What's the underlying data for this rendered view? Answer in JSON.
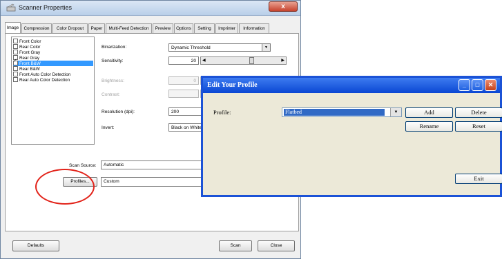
{
  "scanner_window": {
    "title": "Scanner Properties",
    "close_glyph": "x",
    "tabs": [
      "Image",
      "Compression",
      "Color Dropout",
      "Paper",
      "Multi-Feed Detection",
      "Preview",
      "Options",
      "Setting",
      "Imprinter",
      "Information"
    ],
    "active_tab": "Image",
    "image_list": [
      {
        "label": "Front Color",
        "checked": false,
        "selected": false
      },
      {
        "label": "Rear Color",
        "checked": false,
        "selected": false
      },
      {
        "label": "Front Gray",
        "checked": false,
        "selected": false
      },
      {
        "label": "Rear Gray",
        "checked": false,
        "selected": false
      },
      {
        "label": "Front B&W",
        "checked": true,
        "selected": true
      },
      {
        "label": "Rear B&W",
        "checked": false,
        "selected": false
      },
      {
        "label": "Front Auto Color Detection",
        "checked": false,
        "selected": false
      },
      {
        "label": "Rear Auto Color Detection",
        "checked": false,
        "selected": false
      }
    ],
    "settings": {
      "binarization_label": "Binarization:",
      "binarization_value": "Dynamic Threshold",
      "sensitivity_label": "Sensitivity:",
      "sensitivity_value": "20",
      "brightness_label": "Brightness:",
      "brightness_value": "0",
      "contrast_label": "Contrast:",
      "resolution_label": "Resolution (dpi):",
      "resolution_value": "200",
      "invert_label": "Invert:",
      "invert_value": "Black on White"
    },
    "scan_source_label": "Scan Source:",
    "scan_source_value": "Automatic",
    "profiles_button": "Profiles...",
    "profile_value": "Custom",
    "defaults_button": "Defaults",
    "scan_button": "Scan",
    "close_button": "Close",
    "highlight_color": "#e2231a"
  },
  "profile_dialog": {
    "title": "Edit Your Profile",
    "profile_label": "Profile:",
    "profile_value": "Flatbed",
    "add_button": "Add",
    "delete_button": "Delete",
    "rename_button": "Rename",
    "reset_button": "Reset",
    "exit_button": "Exit",
    "title_color": "#0a47d3"
  }
}
